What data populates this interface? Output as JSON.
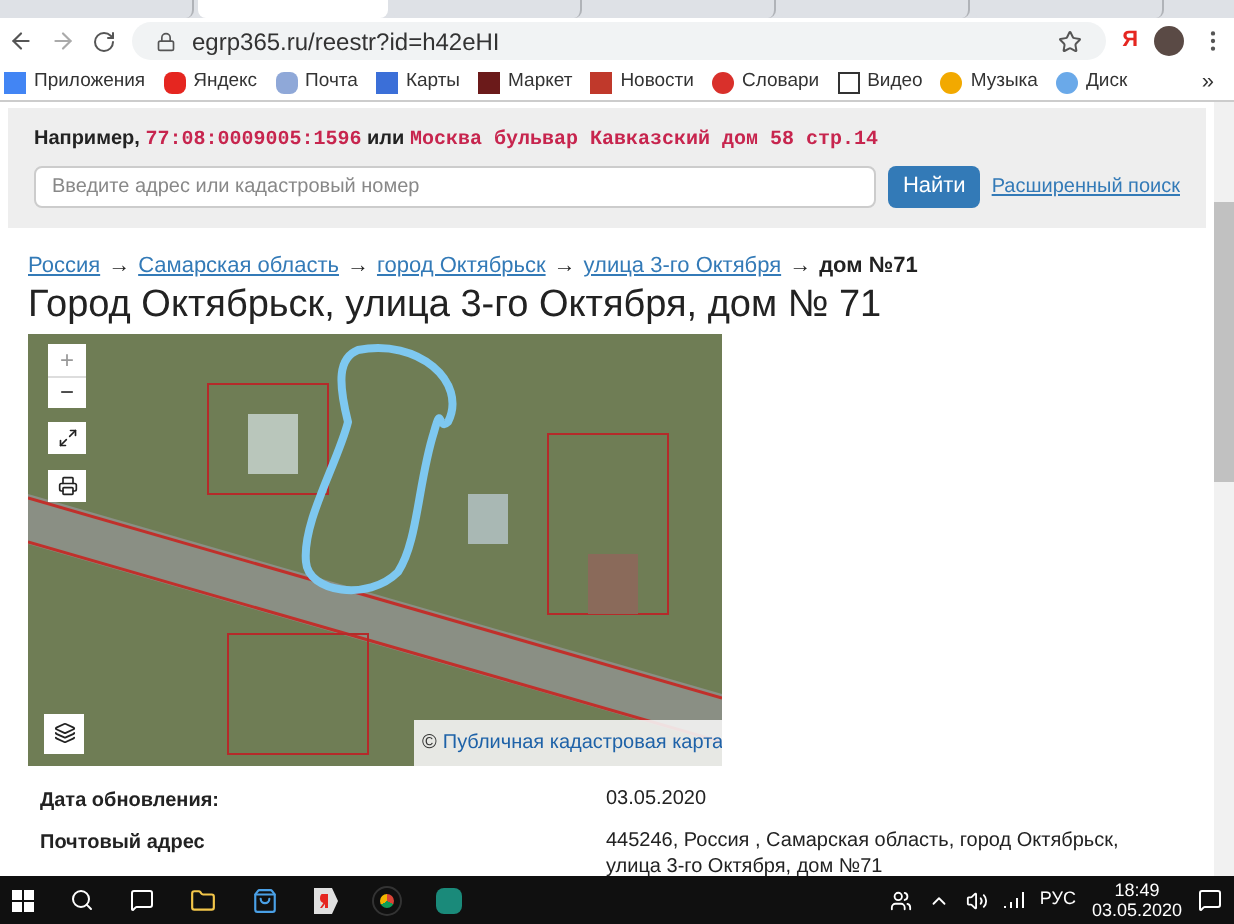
{
  "browser": {
    "tabs": [
      {
        "selected": false
      },
      {
        "selected": true
      },
      {
        "selected": false
      },
      {
        "selected": false
      },
      {
        "selected": false
      },
      {
        "selected": false
      }
    ],
    "url": "egrp365.ru/reestr?id=h42eHI",
    "yandex_button": "Я",
    "bookmarks": [
      "Приложения",
      "Яндекс",
      "Почта",
      "Карты",
      "Маркет",
      "Новости",
      "Словари",
      "Видео",
      "Музыка",
      "Диск"
    ],
    "more": "»"
  },
  "search": {
    "example_label": "Например,",
    "example_code": "77:08:0009005:1596",
    "example_or": "или",
    "example_address": "Москва бульвар Кавказский дом 58 стр.14",
    "placeholder": "Введите адрес или кадастровый номер",
    "button": "Найти",
    "advanced_link": "Расширенный поиск"
  },
  "breadcrumbs": [
    "Россия",
    "Самарская область",
    "город Октябрьск",
    "улица 3-го Октября"
  ],
  "breadcrumb_current": "дом №71",
  "breadcrumb_separator": "→",
  "title": "Город Октябрьск, улица 3-го Октября, дом № 71",
  "map": {
    "zoom_in": "+",
    "zoom_out": "−",
    "attribution": "Публичная кадастровая карта",
    "attribution_mark": "©"
  },
  "details": [
    {
      "label": "Дата обновления:",
      "value": "03.05.2020"
    },
    {
      "label": "Почтовый адрес",
      "value": "445246, Россия , Самарская область, город Октябрьск, улица 3-го Октября, дом №71"
    }
  ],
  "taskbar": {
    "language": "РУС",
    "time": "18:49",
    "date": "03.05.2020"
  }
}
